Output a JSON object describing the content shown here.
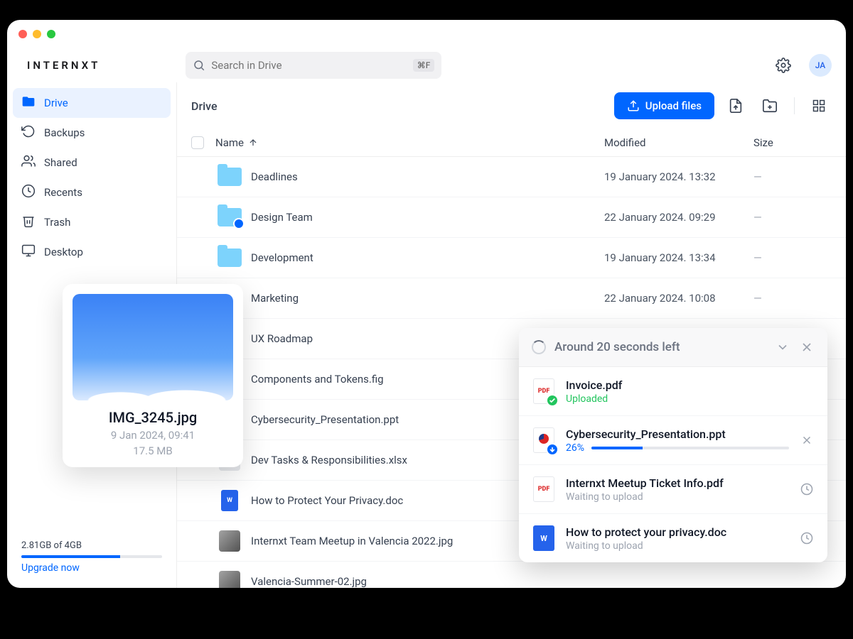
{
  "brand": "INTERNXT",
  "search": {
    "placeholder": "Search in Drive",
    "shortcut": "⌘F"
  },
  "avatar": "JA",
  "sidebar": {
    "items": [
      {
        "label": "Drive",
        "icon": "folder-icon",
        "active": true
      },
      {
        "label": "Backups",
        "icon": "history-icon"
      },
      {
        "label": "Shared",
        "icon": "people-icon"
      },
      {
        "label": "Recents",
        "icon": "clock-icon"
      },
      {
        "label": "Trash",
        "icon": "trash-icon"
      },
      {
        "label": "Desktop",
        "icon": "desktop-icon"
      }
    ]
  },
  "storage": {
    "text": "2.81GB of 4GB",
    "percent": 70,
    "upgrade": "Upgrade now"
  },
  "breadcrumb": "Drive",
  "upload_button": "Upload files",
  "columns": {
    "name": "Name",
    "modified": "Modified",
    "size": "Size"
  },
  "rows": [
    {
      "type": "folder",
      "name": "Deadlines",
      "modified": "19 January 2024. 13:32",
      "size": "—"
    },
    {
      "type": "folder",
      "name": "Design Team",
      "modified": "22 January 2024. 09:29",
      "size": "—",
      "shared": true
    },
    {
      "type": "folder",
      "name": "Development",
      "modified": "19 January 2024. 13:34",
      "size": "—"
    },
    {
      "type": "folder",
      "name": "Marketing",
      "modified": "22 January 2024. 10:08",
      "size": "—"
    },
    {
      "type": "folder",
      "name": "UX Roadmap",
      "modified": "",
      "size": ""
    },
    {
      "type": "file",
      "name": "Components and Tokens.fig",
      "modified": "",
      "size": ""
    },
    {
      "type": "file",
      "name": "Cybersecurity_Presentation.ppt",
      "modified": "",
      "size": ""
    },
    {
      "type": "file",
      "name": "Dev Tasks & Responsibilities.xlsx",
      "modified": "",
      "size": ""
    },
    {
      "type": "doc",
      "name": "How to Protect Your Privacy.doc",
      "modified": "",
      "size": ""
    },
    {
      "type": "image",
      "name": "Internxt Team Meetup in Valencia 2022.jpg",
      "modified": "",
      "size": ""
    },
    {
      "type": "image",
      "name": "Valencia-Summer-02.jpg",
      "modified": "",
      "size": ""
    }
  ],
  "preview": {
    "name": "IMG_3245.jpg",
    "meta1": "9 Jan 2024, 09:41",
    "meta2": "17.5 MB"
  },
  "uploads": {
    "eta": "Around 20 seconds left",
    "items": [
      {
        "name": "Invoice.pdf",
        "status": "Uploaded",
        "state": "done",
        "filetype": "pdf"
      },
      {
        "name": "Cybersecurity_Presentation.ppt",
        "status": "26%",
        "state": "progress",
        "percent": 26,
        "filetype": "ppt"
      },
      {
        "name": "Internxt Meetup Ticket Info.pdf",
        "status": "Waiting to upload",
        "state": "waiting",
        "filetype": "pdf"
      },
      {
        "name": "How to protect your privacy.doc",
        "status": "Waiting to upload",
        "state": "waiting",
        "filetype": "doc"
      }
    ]
  }
}
